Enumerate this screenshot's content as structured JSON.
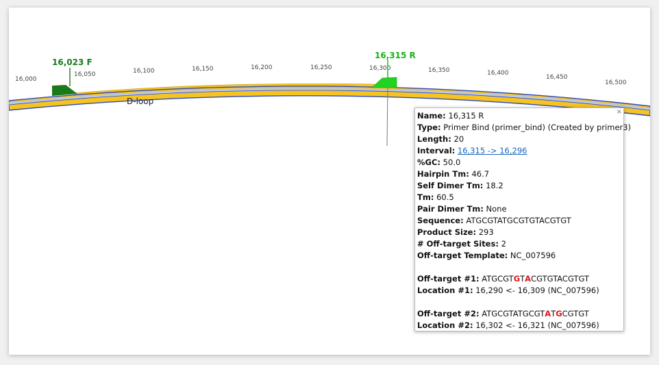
{
  "map": {
    "ticks": [
      "16,000",
      "16,050",
      "16,100",
      "16,150",
      "16,200",
      "16,250",
      "16,300",
      "16,350",
      "16,400",
      "16,450",
      "16,500"
    ],
    "feature_label": "D-loop",
    "primers": {
      "forward": {
        "label": "16,023 F",
        "color": "#1a7a1a"
      },
      "reverse": {
        "label": "16,315 R",
        "color": "#16b316"
      }
    },
    "colors": {
      "strand_fill": "#f5c420",
      "strand_border": "#2b48c8",
      "inner_band": "#b9c8ec"
    }
  },
  "tooltip": {
    "close": "×",
    "name_key": "Name:",
    "name": "16,315 R",
    "type_key": "Type:",
    "type": "Primer Bind (primer_bind) (Created by primer3)",
    "length_key": "Length:",
    "length": "20",
    "interval_key": "Interval:",
    "interval": "16,315 -> 16,296",
    "gc_key": "%GC:",
    "gc": "50.0",
    "hairpin_key": "Hairpin Tm:",
    "hairpin": "46.7",
    "self_dimer_key": "Self Dimer Tm:",
    "self_dimer": "18.2",
    "tm_key": "Tm:",
    "tm": "60.5",
    "pair_dimer_key": "Pair Dimer Tm:",
    "pair_dimer": "None",
    "sequence_key": "Sequence:",
    "sequence": "ATGCGTATGCGTGTACGTGT",
    "product_key": "Product Size:",
    "product": "293",
    "offtarget_sites_key": "# Off-target Sites:",
    "offtarget_sites": "2",
    "offtarget_template_key": "Off-target Template:",
    "offtarget_template": "NC_007596",
    "ot1_key": "Off-target #1:",
    "ot1_a": "ATGCGT",
    "ot1_mm1": "G",
    "ot1_b": "T",
    "ot1_mm2": "A",
    "ot1_c": "CGTGTACGTGT",
    "loc1_key": "Location #1:",
    "loc1": "16,290 <- 16,309 (NC_007596)",
    "ot2_key": "Off-target #2:",
    "ot2_a": "ATGCGTATGCGT",
    "ot2_mm1": "A",
    "ot2_b": "T",
    "ot2_mm2": "G",
    "ot2_c": "CGTGT",
    "loc2_key": "Location #2:",
    "loc2": "16,302 <- 16,321 (NC_007596)",
    "colors": {
      "mismatch": "#e0151b",
      "link": "#1565c0"
    }
  }
}
